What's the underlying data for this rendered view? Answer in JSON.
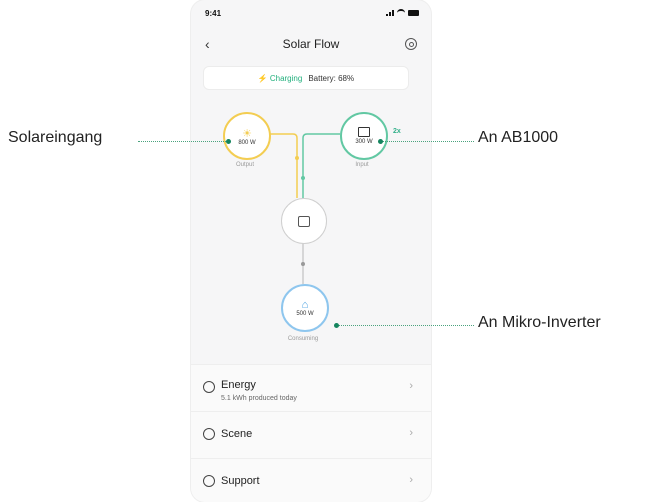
{
  "status_bar": {
    "time": "9:41"
  },
  "header": {
    "title": "Solar Flow",
    "back_icon": "chevron-left-icon",
    "settings_icon": "gear-icon"
  },
  "charging": {
    "state": "Charging",
    "battery": "Battery: 68%"
  },
  "flow": {
    "solar": {
      "value": "800 W",
      "label": "Output"
    },
    "ab1000": {
      "value": "300 W",
      "label": "Input",
      "multiplier": "2x"
    },
    "home": {
      "value": "500 W",
      "label": "Consuming"
    }
  },
  "menu": [
    {
      "label": "Energy",
      "sub": "5.1 kWh produced today",
      "icon": "energy-icon"
    },
    {
      "label": "Scene",
      "sub": "",
      "icon": "scene-icon"
    },
    {
      "label": "Support",
      "sub": "",
      "icon": "support-icon"
    }
  ],
  "annotations": {
    "solar_input": "Solareingang",
    "ab1000": "An AB1000",
    "micro_inverter": "An Mikro-Inverter"
  },
  "colors": {
    "accent": "#22b07d",
    "solar": "#f3cd52",
    "battery": "#62c8a3",
    "home": "#8ec6ee"
  }
}
